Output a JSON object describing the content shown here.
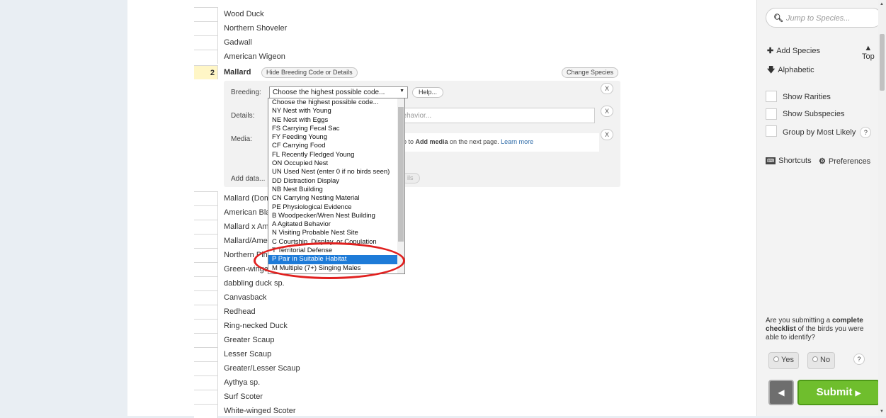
{
  "species_top": [
    "Wood Duck",
    "Northern Shoveler",
    "Gadwall",
    "American Wigeon"
  ],
  "mallard": {
    "count": "2",
    "name": "Mallard",
    "hide_label": "Hide Breeding Code or Details",
    "change_label": "Change Species"
  },
  "panel": {
    "breeding_label": "Breeding:",
    "breeding_value": "Choose the highest possible code...",
    "help_label": "Help...",
    "details_label": "Details:",
    "details_placeholder": "behavior...",
    "media_label": "Media:",
    "media_text_pre": "go to ",
    "media_bold": "Add media",
    "media_text_post": " on the next page. ",
    "media_link": "Learn more",
    "add_data": "Add data...",
    "ghost_btn": "ils",
    "x": "X"
  },
  "dropdown_options": [
    "Choose the highest possible code...",
    "NY Nest with Young",
    "NE Nest with Eggs",
    "FS Carrying Fecal Sac",
    "FY Feeding Young",
    "CF Carrying Food",
    "FL Recently Fledged Young",
    "ON Occupied Nest",
    "UN Used Nest (enter 0 if no birds seen)",
    "DD Distraction Display",
    "NB Nest Building",
    "CN Carrying Nesting Material",
    "PE Physiological Evidence",
    "B Woodpecker/Wren Nest Building",
    "A Agitated Behavior",
    "N Visiting Probable Nest Site",
    "C Courtship, Display, or Copulation",
    "T Territorial Defense",
    "P Pair in Suitable Habitat",
    "M Multiple (7+) Singing Males"
  ],
  "species_bottom": [
    "Mallard (Dom",
    "American Bla",
    "Mallard x Am",
    "Mallard/Amer",
    "Northern Pint",
    "Green-winge",
    "dabbling duck sp.",
    "Canvasback",
    "Redhead",
    "Ring-necked Duck",
    "Greater Scaup",
    "Lesser Scaup",
    "Greater/Lesser Scaup",
    "Aythya sp.",
    "Surf Scoter",
    "White-winged Scoter"
  ],
  "sidebar": {
    "search_placeholder": "Jump to Species...",
    "add_species": "Add Species",
    "alphabetic": "Alphabetic",
    "top": "Top",
    "show_rarities": "Show Rarities",
    "show_subspecies": "Show Subspecies",
    "group_likely": "Group by Most Likely",
    "q": "?",
    "shortcuts": "Shortcuts",
    "preferences": "Preferences",
    "complete_pre": "Are you submitting a ",
    "complete_bold": "complete checklist",
    "complete_post": " of the birds you were able to identify?",
    "yes": "Yes",
    "no": "No",
    "submit": "Submit"
  },
  "colors": {
    "highlight": "#1e7bd8",
    "annotation": "#e0201f",
    "submit": "#6fbe2d",
    "count_bg": "#fff6c6"
  },
  "icons": [
    "search-icon",
    "plus-icon",
    "arrow-down-icon",
    "arrow-up-icon",
    "keyboard-icon",
    "gear-icon",
    "chevron-left-icon",
    "chevron-right-icon"
  ]
}
